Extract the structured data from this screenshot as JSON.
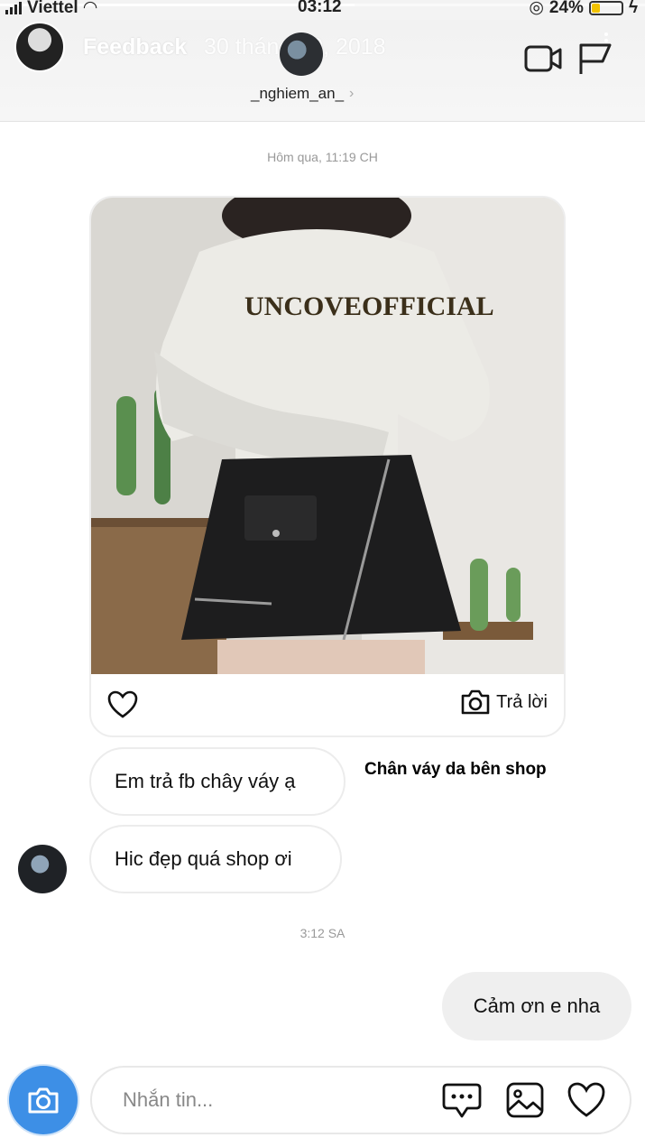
{
  "status_bar": {
    "carrier": "Viettel",
    "time": "03:12",
    "battery": "24%",
    "story_progress": 0.55
  },
  "story": {
    "title": "Feedback",
    "date": "30 tháng 10, 2018"
  },
  "chat": {
    "username": "_nghiem_an_"
  },
  "messages": {
    "timestamp_1": "Hôm qua, 11:19 CH",
    "reply_button_label": "Trả lời",
    "bubble_1": "Em trả fb chây váy ạ",
    "caption": "Chân váy da bên shop",
    "bubble_2": "Hic đẹp quá shop ơi",
    "timestamp_2": "3:12 SA",
    "own_reply": "Cảm ơn e nha"
  },
  "composer": {
    "placeholder": "Nhắn tin..."
  },
  "colors": {
    "accent_blue": "#3d8fe6",
    "bubble_border": "#ececec",
    "own_bubble": "#efefef"
  }
}
